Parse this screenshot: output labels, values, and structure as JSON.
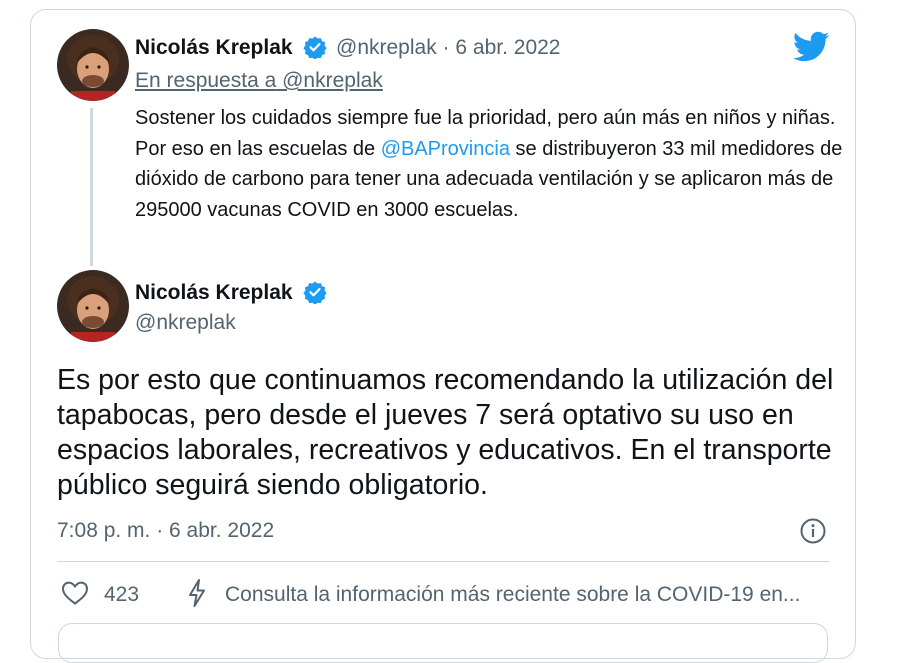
{
  "colors": {
    "link": "#1d9bf0",
    "muted": "#536471",
    "text": "#0f1419",
    "border": "#cfd9de"
  },
  "icons": [
    "twitter-bird-icon",
    "verified-badge-icon",
    "info-icon",
    "heart-icon",
    "bolt-icon"
  ],
  "parent_tweet": {
    "author_name": "Nicolás Kreplak",
    "handle": "@nkreplak",
    "separator": "·",
    "date": "6 abr. 2022",
    "reply_label": "En respuesta a",
    "reply_handle": "@nkreplak",
    "text_before_mention": "Sostener los cuidados siempre fue la prioridad, pero aún más en niños y niñas. Por eso en las escuelas de ",
    "mention": "@BAProvincia",
    "text_after_mention": " se distribuyeron 33 mil medidores de dióxido de carbono para tener una adecuada ventilación y se aplicaron más de 295000 vacunas COVID en 3000 escuelas."
  },
  "main_tweet": {
    "author_name": "Nicolás Kreplak",
    "handle": "@nkreplak",
    "text": "Es por esto que continuamos recomendando la utilización del tapabocas, pero desde el jueves 7 será optativo su uso en espacios laborales, recreativos y educativos. En el transporte público seguirá siendo obligatorio.",
    "timestamp": "7:08 p. m. · 6 abr. 2022",
    "like_count": "423",
    "covid_info_link": "Consulta la información más reciente sobre la COVID-19 en..."
  }
}
